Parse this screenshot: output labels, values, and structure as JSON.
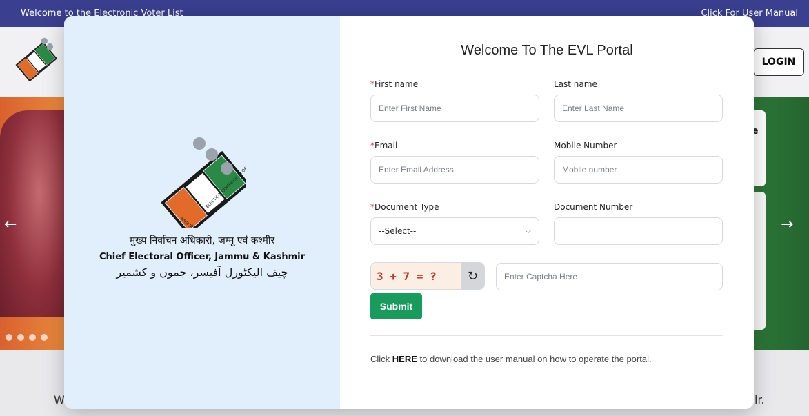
{
  "topbar": {
    "welcome_text": "Welcome to the Electronic Voter List",
    "manual_link": "Click For User Manual"
  },
  "header": {
    "login_label": "LOGIN"
  },
  "banner": {
    "right_card_partial": "e",
    "left_arrow": "←",
    "right_arrow": "→",
    "slide_count": 4
  },
  "background": {
    "text_left": "W",
    "text_right": "ir."
  },
  "modal": {
    "org_hindi": "मुख्य निर्वाचन अधिकारी, जम्मू एवं कश्मीर",
    "org_english": "Chief Electoral Officer, Jammu & Kashmir",
    "org_urdu": "چیف الیکٹورل آفیسر، جموں و کشمیر",
    "title": "Welcome To The EVL Portal",
    "form": {
      "first_name": {
        "label": "First name",
        "required": "*",
        "placeholder": "Enter First Name"
      },
      "last_name": {
        "label": "Last name",
        "placeholder": "Enter Last Name"
      },
      "email": {
        "label": "Email",
        "required": "*",
        "placeholder": "Enter Email Address"
      },
      "mobile": {
        "label": "Mobile Number",
        "placeholder": "Mobile number"
      },
      "doc_type": {
        "label": "Document Type",
        "required": "*",
        "selected": "--Select--"
      },
      "doc_number": {
        "label": "Document Number",
        "placeholder": ""
      },
      "captcha": {
        "expression": "3 + 7 = ?",
        "placeholder": "Enter Captcha Here"
      },
      "submit_label": "Submit"
    },
    "note": {
      "prefix": "Click ",
      "link": "HERE",
      "suffix": " to download the user manual on how to operate the portal."
    }
  },
  "colors": {
    "topbar": "#3a3f8f",
    "submit": "#1a9b5e",
    "left_panel": "#e1eefb",
    "required": "#d32f2f",
    "captcha_text": "#c0392b",
    "logo_orange": "#e26b2a",
    "logo_green": "#2a8a45"
  }
}
